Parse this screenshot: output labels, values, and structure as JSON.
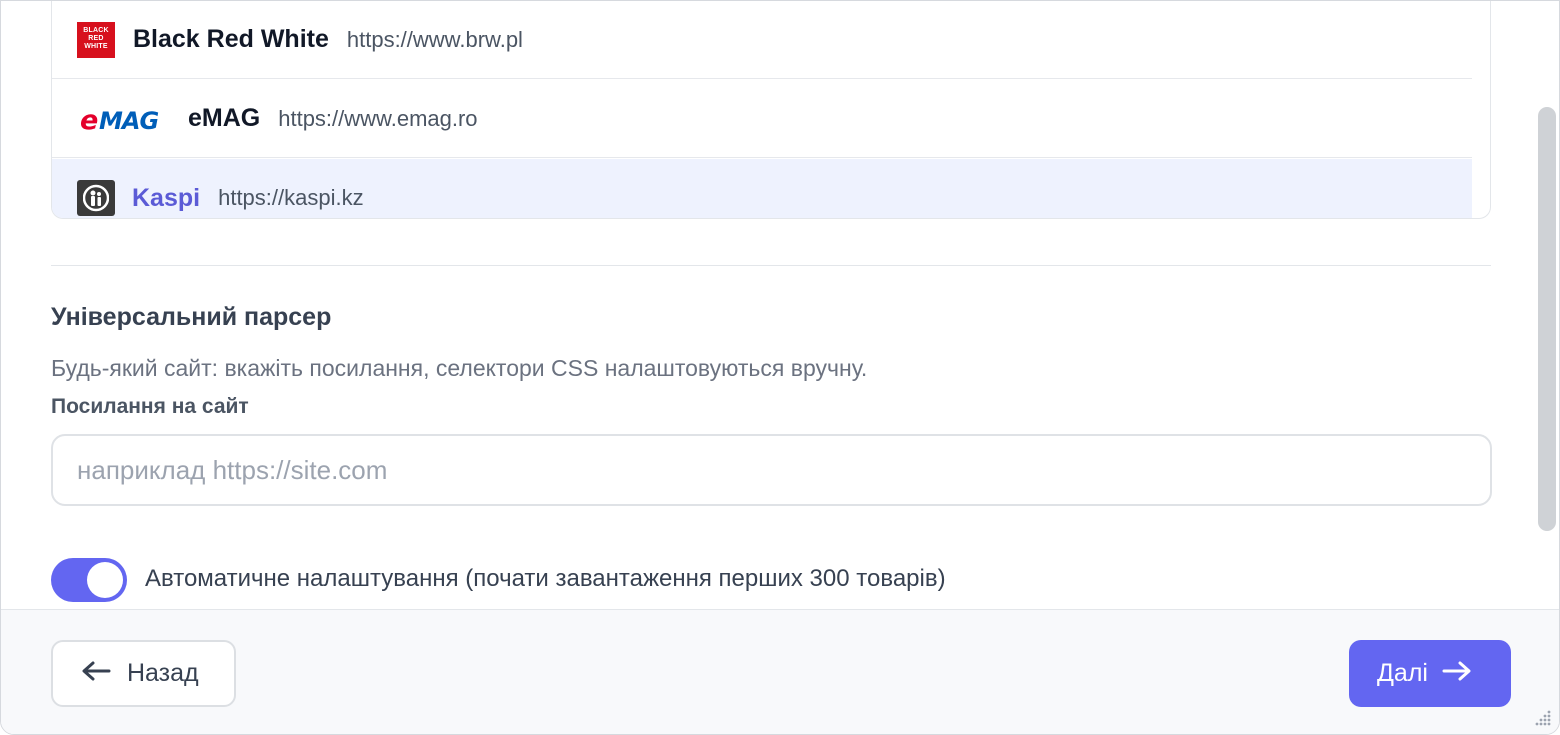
{
  "sites": [
    {
      "name": "Black Red White",
      "url": "https://www.brw.pl",
      "logo": "brw-logo",
      "logo_text": [
        "BLACK",
        "RED",
        "WHITE"
      ],
      "selected": false
    },
    {
      "name": "eMAG",
      "url": "https://www.emag.ro",
      "logo": "emag-logo",
      "logo_text": "eMAG",
      "selected": false
    },
    {
      "name": "Kaspi",
      "url": "https://kaspi.kz",
      "logo": "kaspi-logo",
      "selected": true
    }
  ],
  "universal": {
    "title": "Універсальний парсер",
    "description": "Будь-який сайт: вкажіть посилання, селектори CSS налаштовуються вручну.",
    "field_label": "Посилання на сайт",
    "input_value": "",
    "input_placeholder": "наприклад https://site.com"
  },
  "auto_setup": {
    "enabled": true,
    "label": "Автоматичне налаштування (почати завантаження перших 300 товарів)"
  },
  "footer": {
    "back_label": "Назад",
    "next_label": "Далі"
  },
  "colors": {
    "accent": "#6366f1",
    "selected_row_bg": "#eef2fe",
    "brw_red": "#d7101d",
    "emag_red": "#e4002b",
    "emag_blue": "#005eb8"
  }
}
